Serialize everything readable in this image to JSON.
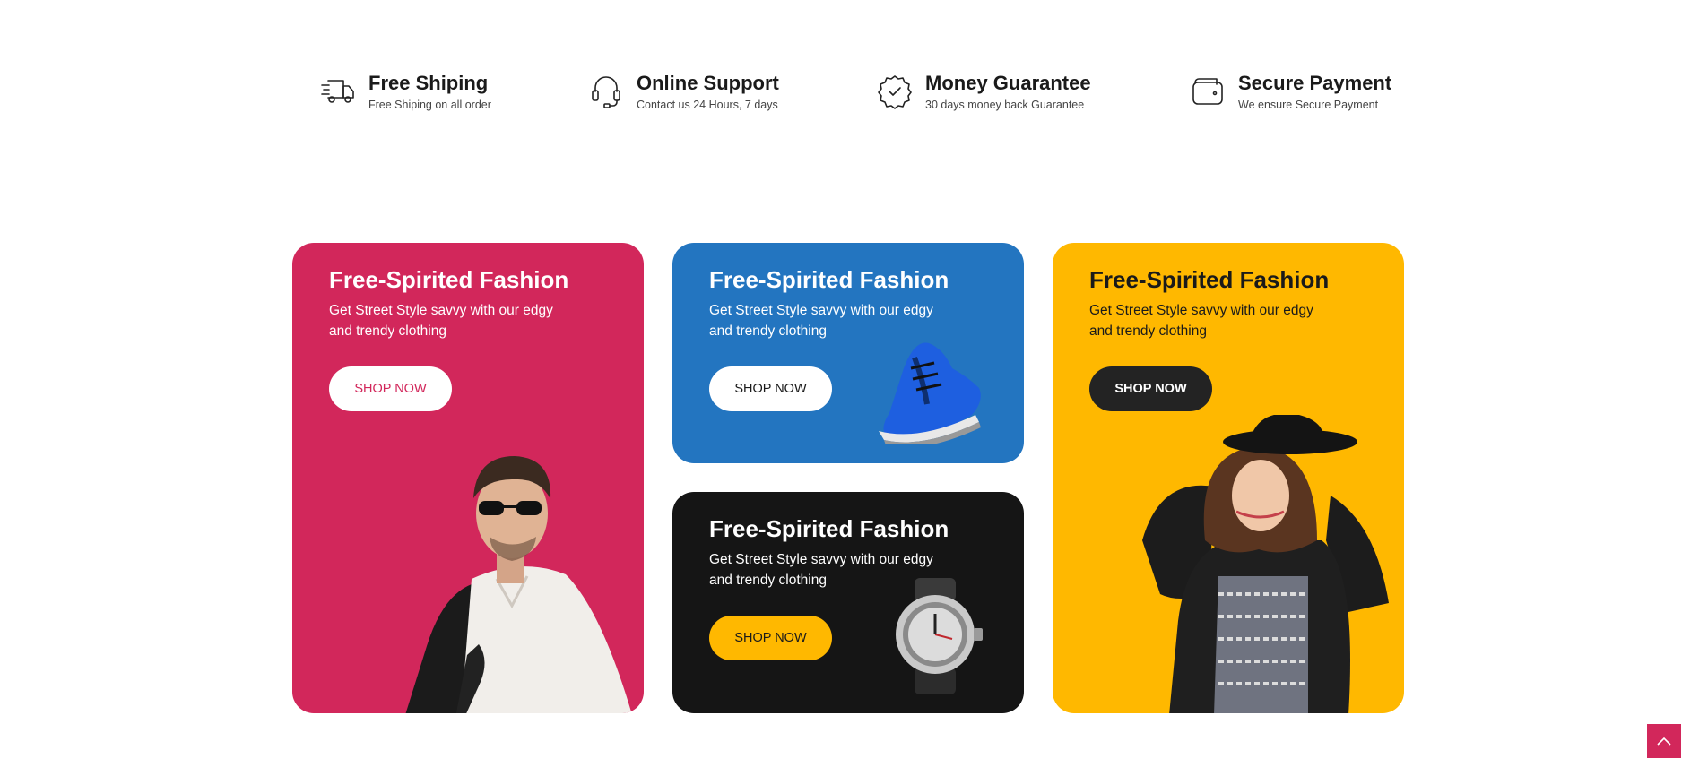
{
  "features": [
    {
      "icon": "truck-icon",
      "title": "Free Shiping",
      "subtitle": "Free Shiping on all order"
    },
    {
      "icon": "headset-icon",
      "title": "Online Support",
      "subtitle": "Contact us 24 Hours, 7 days"
    },
    {
      "icon": "badge-check-icon",
      "title": "Money Guarantee",
      "subtitle": "30 days money back Guarantee"
    },
    {
      "icon": "wallet-icon",
      "title": "Secure Payment",
      "subtitle": "We ensure Secure Payment"
    }
  ],
  "promos": [
    {
      "title": "Free-Spirited Fashion",
      "text": "Get Street Style savvy with our edgy and trendy clothing",
      "button": "SHOP NOW",
      "color": "#d2275b"
    },
    {
      "title": "Free-Spirited Fashion",
      "text": "Get Street Style savvy with our edgy and trendy clothing",
      "button": "SHOP NOW",
      "color": "#2375c0"
    },
    {
      "title": "Free-Spirited Fashion",
      "text": "Get Street Style savvy with our edgy and trendy clothing",
      "button": "SHOP NOW",
      "color": "#151515"
    },
    {
      "title": "Free-Spirited Fashion",
      "text": "Get Street Style savvy with our edgy and trendy clothing",
      "button": "SHOP NOW",
      "color": "#ffb800"
    }
  ],
  "scroll_top": {
    "icon": "chevron-up-icon",
    "color": "#d2275b"
  }
}
